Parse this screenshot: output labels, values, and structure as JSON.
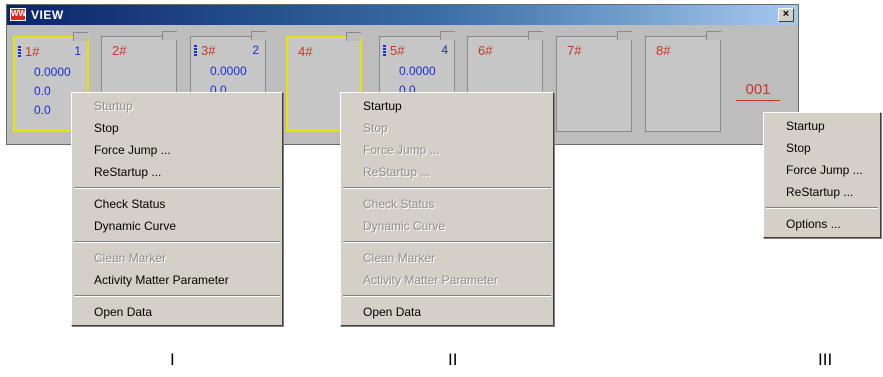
{
  "window": {
    "icon_text": "WW",
    "title": "VIEW",
    "close_label": "×"
  },
  "channels": [
    {
      "label": "1#",
      "count": "1",
      "value1": "0.0000",
      "value2": "0.0",
      "value3": "0.0",
      "active": true
    },
    {
      "label": "2#",
      "count": "",
      "value1": "",
      "value2": "",
      "value3": "",
      "active": false
    },
    {
      "label": "3#",
      "count": "2",
      "value1": "0.0000",
      "value2": "0.0",
      "value3": "",
      "active": false
    },
    {
      "label": "4#",
      "count": "",
      "value1": "",
      "value2": "",
      "value3": "",
      "active": true
    },
    {
      "label": "5#",
      "count": "4",
      "value1": "0.0000",
      "value2": "0.0",
      "value3": "",
      "active": false
    },
    {
      "label": "6#",
      "count": "",
      "value1": "",
      "value2": "",
      "value3": "",
      "active": false
    },
    {
      "label": "7#",
      "count": "",
      "value1": "",
      "value2": "",
      "value3": "",
      "active": false
    },
    {
      "label": "8#",
      "count": "",
      "value1": "",
      "value2": "",
      "value3": "",
      "active": false
    }
  ],
  "counter": "001",
  "menus": {
    "menu1": [
      {
        "label": "Startup",
        "disabled": true
      },
      {
        "label": "Stop"
      },
      {
        "label": "Force Jump ..."
      },
      {
        "label": "ReStartup ..."
      },
      {
        "sep": true
      },
      {
        "label": "Check Status"
      },
      {
        "label": "Dynamic Curve"
      },
      {
        "sep": true
      },
      {
        "label": "Clean Marker",
        "disabled": true
      },
      {
        "label": "Activity Matter Parameter"
      },
      {
        "sep": true
      },
      {
        "label": "Open Data"
      }
    ],
    "menu2": [
      {
        "label": "Startup"
      },
      {
        "label": "Stop",
        "disabled": true
      },
      {
        "label": "Force Jump ...",
        "disabled": true
      },
      {
        "label": "ReStartup ...",
        "disabled": true
      },
      {
        "sep": true
      },
      {
        "label": "Check Status",
        "disabled": true
      },
      {
        "label": "Dynamic Curve",
        "disabled": true
      },
      {
        "sep": true
      },
      {
        "label": "Clean Marker",
        "disabled": true
      },
      {
        "label": "Activity Matter Parameter",
        "disabled": true
      },
      {
        "sep": true
      },
      {
        "label": "Open Data"
      }
    ],
    "menu3": [
      {
        "label": "Startup"
      },
      {
        "label": "Stop"
      },
      {
        "label": "Force Jump ..."
      },
      {
        "label": "ReStartup ..."
      },
      {
        "sep": true
      },
      {
        "label": "Options ..."
      }
    ]
  },
  "captions": [
    "I",
    "II",
    "III"
  ]
}
